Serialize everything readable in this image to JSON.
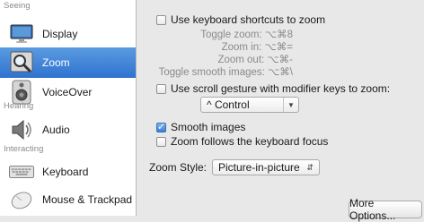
{
  "sidebar": {
    "sections": {
      "seeing": "Seeing",
      "hearing": "Hearing",
      "interacting": "Interacting"
    },
    "items": [
      {
        "label": "Display",
        "icon": "display-icon",
        "selected": false
      },
      {
        "label": "Zoom",
        "icon": "zoom-icon",
        "selected": true
      },
      {
        "label": "VoiceOver",
        "icon": "voiceover-icon",
        "selected": false
      },
      {
        "label": "Audio",
        "icon": "speaker-icon",
        "selected": false
      },
      {
        "label": "Keyboard",
        "icon": "keyboard-icon",
        "selected": false
      },
      {
        "label": "Mouse & Trackpad",
        "icon": "mouse-icon",
        "selected": false
      }
    ]
  },
  "main": {
    "keyboard_shortcuts": {
      "label": "Use keyboard shortcuts to zoom",
      "checked": false
    },
    "shortcuts": {
      "toggle_zoom": "Toggle zoom: ⌥⌘8",
      "zoom_in": "Zoom in: ⌥⌘=",
      "zoom_out": "Zoom out: ⌥⌘-",
      "toggle_smooth": "Toggle smooth images: ⌥⌘\\"
    },
    "scroll_gesture": {
      "label": "Use scroll gesture with modifier keys to zoom:",
      "checked": false
    },
    "modifier_select": {
      "value": "^ Control"
    },
    "smooth_images": {
      "label": "Smooth images",
      "checked": true
    },
    "follow_focus": {
      "label": "Zoom follows the keyboard focus",
      "checked": false
    },
    "zoom_style": {
      "label": "Zoom Style:",
      "value": "Picture-in-picture"
    },
    "more_options": "More Options..."
  },
  "colors": {
    "selection": "#3d80d6",
    "pane_background": "#e8e8e8",
    "secondary_text": "#8a8a8a"
  }
}
